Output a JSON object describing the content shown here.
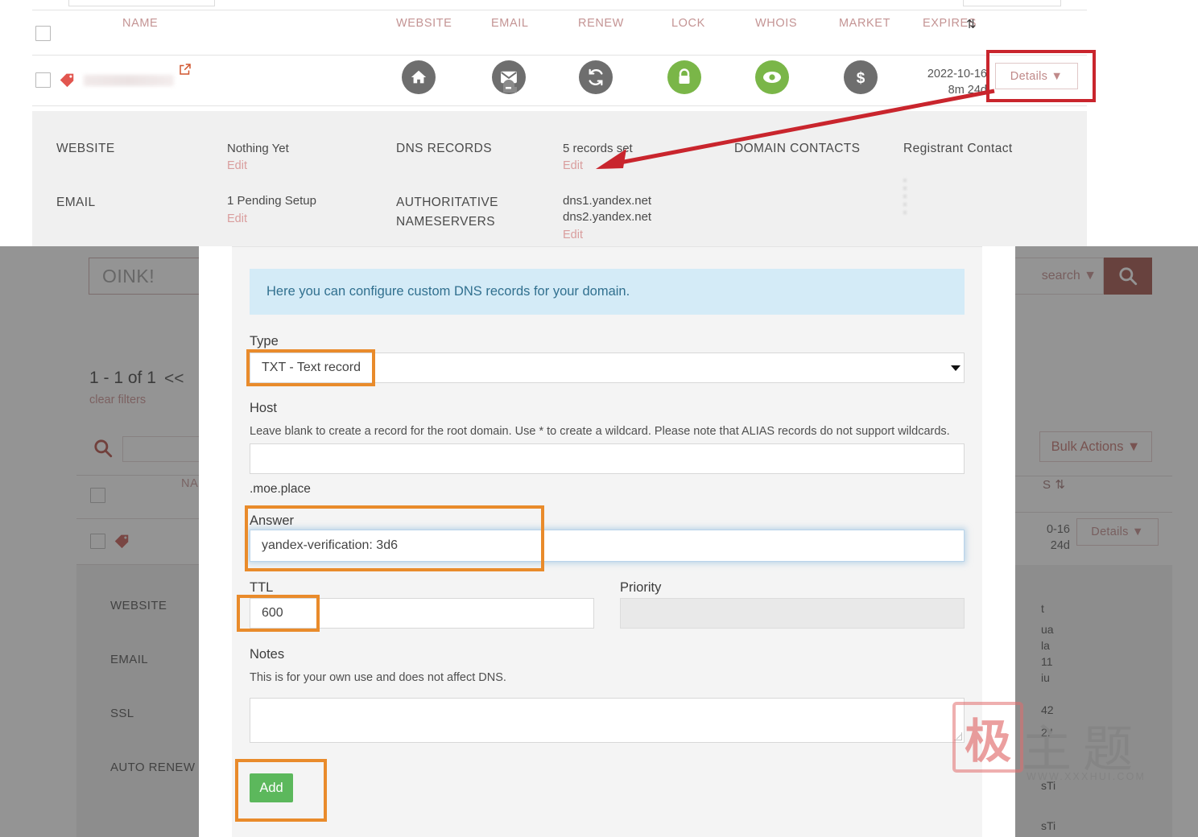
{
  "table": {
    "columns": [
      "NAME",
      "WEBSITE",
      "EMAIL",
      "RENEW",
      "LOCK",
      "WHOIS",
      "MARKET",
      "EXPIRES"
    ],
    "sort_indicator": "⇅",
    "row": {
      "expires_date": "2022-10-16",
      "expires_remaining": "8m 24d",
      "details_label": "Details ▼",
      "icons": [
        {
          "name": "website-home-icon",
          "state": "gray"
        },
        {
          "name": "email-mailbox-icon",
          "state": "gray"
        },
        {
          "name": "renew-refresh-icon",
          "state": "gray"
        },
        {
          "name": "lock-icon",
          "state": "green"
        },
        {
          "name": "whois-eye-icon",
          "state": "green"
        },
        {
          "name": "market-dollar-icon",
          "state": "gray"
        }
      ]
    }
  },
  "detail_panel": {
    "website_label": "WEBSITE",
    "website_value": "Nothing Yet",
    "website_edit": "Edit",
    "email_label": "EMAIL",
    "email_value": "1 Pending Setup",
    "email_edit": "Edit",
    "dns_label": "DNS RECORDS",
    "dns_value": "5 records set",
    "dns_edit": "Edit",
    "ns_label_line1": "AUTHORITATIVE",
    "ns_label_line2": "NAMESERVERS",
    "ns_value_line1": "dns1.yandex.net",
    "ns_value_line2": "dns2.yandex.net",
    "ns_edit": "Edit",
    "contacts_label": "DOMAIN CONTACTS",
    "registrant_label": "Registrant Contact"
  },
  "background_left": {
    "oink_placeholder": "OINK!",
    "pagination": "1 - 1 of 1",
    "pagination_prev": "<<",
    "clear_filters": "clear filters",
    "column_name": "NAM",
    "side_labels": [
      "WEBSITE",
      "EMAIL",
      "SSL",
      "AUTO RENEW"
    ]
  },
  "background_right": {
    "search_dropdown": "search ▼",
    "search_icon": "search-icon",
    "bulk_actions": "Bulk Actions ▼",
    "expires_sort": "S ⇅",
    "expires_date_frag": "0-16",
    "expires_remaining_frag": "24d",
    "details_label": "Details ▼",
    "registrant_fragments": [
      "t",
      "ua",
      "la",
      "11",
      "iu",
      "42",
      "2.'",
      "sTi",
      "sTi"
    ]
  },
  "modal": {
    "alert_text": "Here you can configure custom DNS records for your domain.",
    "type_label": "Type",
    "type_value": "TXT - Text record",
    "host_label": "Host",
    "host_help": "Leave blank to create a record for the root domain. Use * to create a wildcard. Please note that ALIAS records do not support wildcards.",
    "host_value": "",
    "host_suffix": ".moe.place",
    "answer_label": "Answer",
    "answer_value": "yandex-verification: 3d6",
    "ttl_label": "TTL",
    "ttl_value": "600",
    "priority_label": "Priority",
    "priority_value": "",
    "notes_label": "Notes",
    "notes_help": "This is for your own use and does not affect DNS.",
    "notes_value": "",
    "add_label": "Add"
  },
  "watermark": {
    "seal_char": "极",
    "main_text": "主题",
    "sub_text": "WWW.XXXHUI.COM"
  },
  "colors": {
    "accent_red": "#c9252d",
    "accent_orange": "#e98b2b",
    "green": "#5cb85c",
    "icon_green": "#7ab648",
    "icon_gray": "#6e6e6e",
    "alert_bg": "#d4ebf7",
    "alert_text": "#31708f",
    "link_pink": "#d99d9d"
  }
}
